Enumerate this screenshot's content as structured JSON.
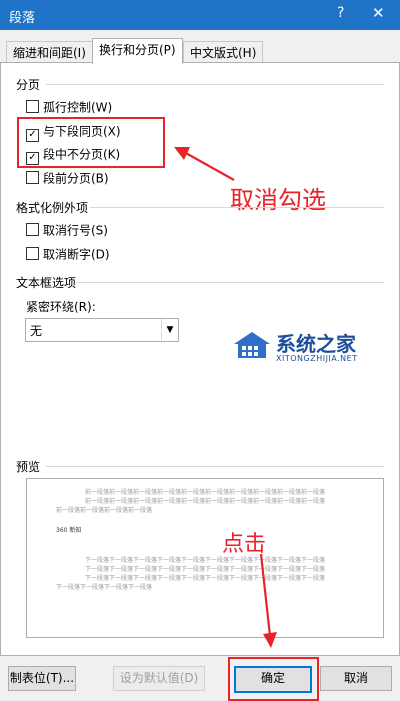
{
  "window": {
    "title": "段落",
    "help_glyph": "?",
    "close_glyph": "✕"
  },
  "tabs": [
    {
      "label": "缩进和间距(I)"
    },
    {
      "label": "换行和分页(P)"
    },
    {
      "label": "中文版式(H)"
    }
  ],
  "pagination": {
    "heading": "分页",
    "options": [
      {
        "label": "孤行控制(W)",
        "checked": false
      },
      {
        "label": "与下段同页(X)",
        "checked": true
      },
      {
        "label": "段中不分页(K)",
        "checked": true
      },
      {
        "label": "段前分页(B)",
        "checked": false
      }
    ]
  },
  "format_exceptions": {
    "heading": "格式化例外项",
    "options": [
      {
        "label": "取消行号(S)",
        "checked": false
      },
      {
        "label": "取消断字(D)",
        "checked": false
      }
    ]
  },
  "textbox": {
    "heading": "文本框选项",
    "wrap_label": "紧密环绕(R):",
    "wrap_value": "无"
  },
  "preview": {
    "heading": "预览",
    "prev_lines": [
      "前一段落前一段落前一段落前一段落前一段落前一段落前一段落前一段落前一段落前一段落",
      "前一段落前一段落前一段落前一段落前一段落前一段落前一段落前一段落前一段落前一段落",
      "前一段落前一段落前一段落前一段落"
    ],
    "sample_text": "360 新知",
    "next_lines": [
      "下一段落下一段落下一段落下一段落下一段落下一段落下一段落下一段落下一段落下一段落",
      "下一段落下一段落下一段落下一段落下一段落下一段落下一段落下一段落下一段落下一段落",
      "下一段落下一段落下一段落下一段落下一段落下一段落下一段落下一段落下一段落下一段落",
      "下一段落下一段落下一段落下一段落"
    ]
  },
  "buttons": {
    "tabs": "制表位(T)...",
    "set_default": "设为默认值(D)",
    "ok": "确定",
    "cancel": "取消"
  },
  "annotations": {
    "uncheck_text": "取消勾选",
    "click_text": "点击",
    "color": "#e8232a"
  },
  "watermark": {
    "brand": "系统之家",
    "url": "XITONGZHIJIA.NET"
  }
}
